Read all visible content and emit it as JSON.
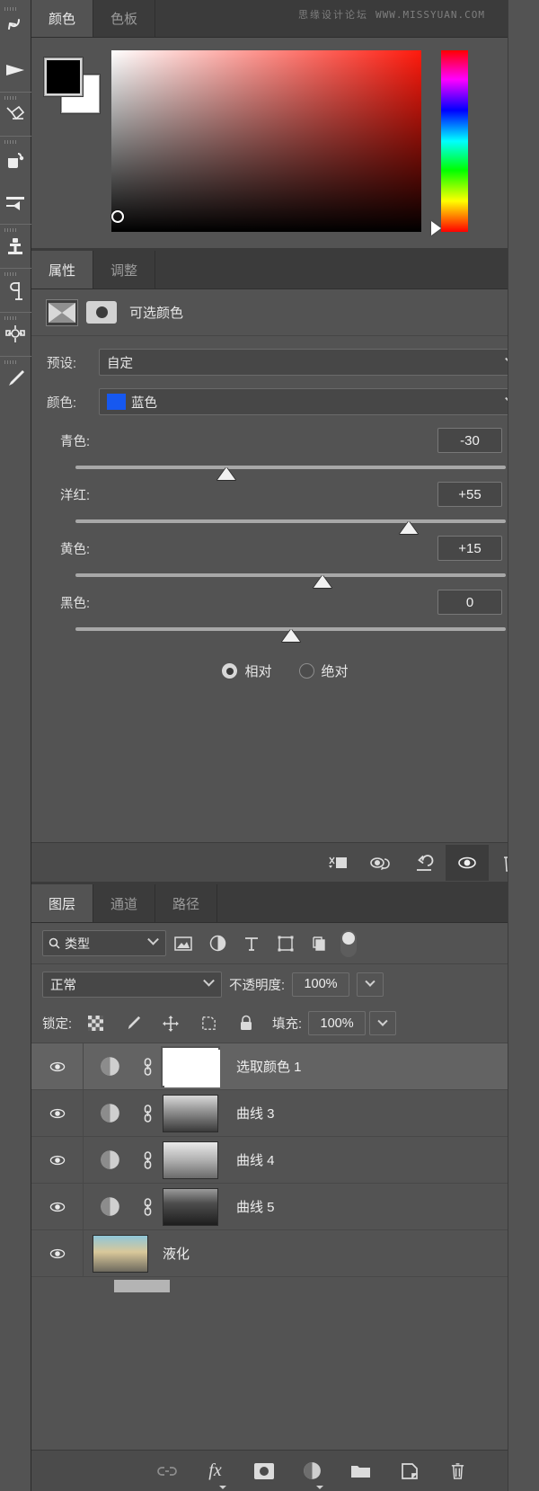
{
  "watermark": {
    "cn": "思缘设计论坛",
    "url": "WWW.MISSYUAN.COM"
  },
  "toolbar": {
    "tools": [
      {
        "name": "history-brush-tool",
        "label": "历史记录画笔工具"
      },
      {
        "name": "direct-selection-tool",
        "label": "直接选择工具"
      },
      {
        "name": "eraser-tool",
        "label": "橡皮擦工具"
      },
      {
        "name": "paint-bucket-tool",
        "label": "油漆桶工具"
      },
      {
        "name": "gradient-tool",
        "label": "渐变工具"
      },
      {
        "name": "clone-stamp-tool",
        "label": "仿制图章工具"
      },
      {
        "name": "type-tool",
        "label": "文字工具"
      },
      {
        "name": "pen-tool",
        "label": "钢笔工具"
      },
      {
        "name": "brush-tool",
        "label": "画笔工具"
      }
    ]
  },
  "color_panel": {
    "tabs": [
      {
        "label": "颜色",
        "active": true
      },
      {
        "label": "色板",
        "active": false
      }
    ],
    "foreground_color": "#000000",
    "background_color": "#ffffff",
    "gradient_from": "#ffffff",
    "gradient_to": "#ff1a0d"
  },
  "properties_panel": {
    "tabs": [
      {
        "label": "属性",
        "active": true
      },
      {
        "label": "调整",
        "active": false
      }
    ],
    "adjustment_title": "可选颜色",
    "preset_label": "预设:",
    "preset_value": "自定",
    "color_label": "颜色:",
    "color_value": "蓝色",
    "color_swatch": "#1658f0",
    "sliders": [
      {
        "label": "青色:",
        "value": "-30",
        "unit": "%",
        "pos": 35
      },
      {
        "label": "洋红:",
        "value": "+55",
        "unit": "%",
        "pos": 77.5
      },
      {
        "label": "黄色:",
        "value": "+15",
        "unit": "%",
        "pos": 57.5
      },
      {
        "label": "黑色:",
        "value": "0",
        "unit": "%",
        "pos": 50
      }
    ],
    "method": [
      {
        "label": "相对",
        "selected": true
      },
      {
        "label": "绝对",
        "selected": false
      }
    ],
    "footer_buttons": [
      {
        "name": "clip-to-layer-icon",
        "active": false
      },
      {
        "name": "view-previous-state-icon",
        "active": false
      },
      {
        "name": "reset-icon",
        "active": false
      },
      {
        "name": "toggle-visibility-icon",
        "active": true
      },
      {
        "name": "delete-adjustment-icon",
        "active": false
      }
    ]
  },
  "layers_panel": {
    "tabs": [
      {
        "label": "图层",
        "active": true
      },
      {
        "label": "通道",
        "active": false
      },
      {
        "label": "路径",
        "active": false
      }
    ],
    "filter_type": "类型",
    "filter_icons": [
      "pixel-layer-filter-icon",
      "adjustment-layer-filter-icon",
      "type-layer-filter-icon",
      "shape-layer-filter-icon",
      "smart-object-filter-icon"
    ],
    "blend_mode": "正常",
    "opacity_label": "不透明度:",
    "opacity_value": "100%",
    "lock_label": "锁定:",
    "lock_icons": [
      "lock-transparent-pixels-icon",
      "lock-image-pixels-icon",
      "lock-position-icon",
      "lock-artboard-nesting-icon",
      "lock-all-icon"
    ],
    "fill_label": "填充:",
    "fill_value": "100%",
    "layers": [
      {
        "name": "选取颜色 1",
        "type": "adjustment",
        "selected": true,
        "visible": true,
        "linked": true,
        "thumb": "mask"
      },
      {
        "name": "曲线 3",
        "type": "adjustment",
        "selected": false,
        "visible": true,
        "linked": true,
        "thumb": "tn1"
      },
      {
        "name": "曲线 4",
        "type": "adjustment",
        "selected": false,
        "visible": true,
        "linked": true,
        "thumb": "tn2"
      },
      {
        "name": "曲线 5",
        "type": "adjustment",
        "selected": false,
        "visible": true,
        "linked": true,
        "thumb": "tn3"
      },
      {
        "name": "液化",
        "type": "pixel",
        "selected": false,
        "visible": true,
        "linked": false,
        "thumb": "tn4"
      }
    ],
    "footer_buttons": [
      {
        "name": "link-layers-icon",
        "dim": true
      },
      {
        "name": "layer-style-fx-icon",
        "dim": false
      },
      {
        "name": "add-layer-mask-icon",
        "dim": false
      },
      {
        "name": "new-adjustment-layer-icon",
        "dim": false
      },
      {
        "name": "new-group-icon",
        "dim": false
      },
      {
        "name": "new-layer-icon",
        "dim": false
      },
      {
        "name": "delete-layer-icon",
        "dim": false
      }
    ]
  }
}
